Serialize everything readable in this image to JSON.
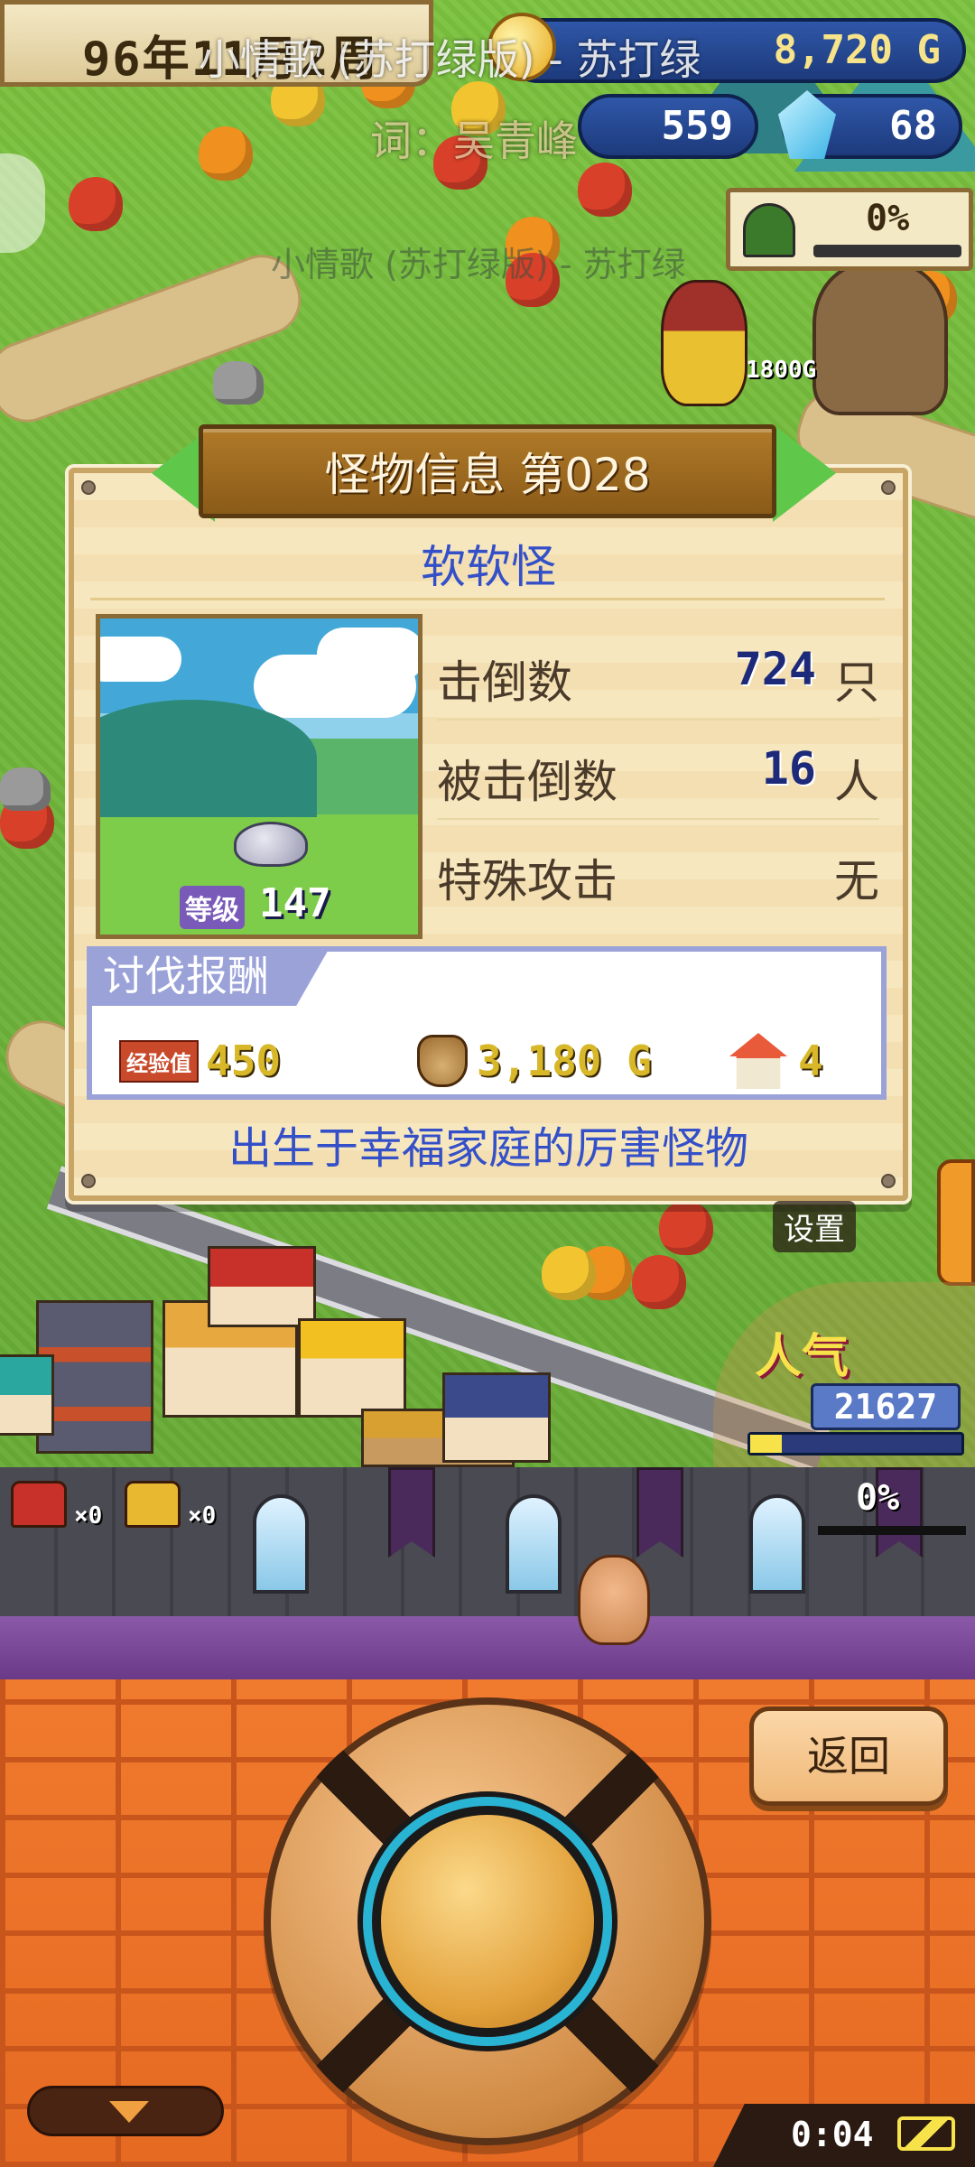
{
  "hud": {
    "date": "96年11月2周",
    "money": "8,720 G",
    "stat_value": "559",
    "gems": "68",
    "quest_progress": "0%"
  },
  "overlay_lyrics": {
    "line1": "小情歌 (苏打绿版) - 苏打绿",
    "line2": "词：吴青峰",
    "line3": "小情歌 (苏打绿版) - 苏打绿"
  },
  "map": {
    "price_tag": "1800G"
  },
  "dialog": {
    "title": "怪物信息 第028",
    "monster_name": "软软怪",
    "level_label": "等级",
    "level_value": "147",
    "stats": [
      {
        "label": "击倒数",
        "value": "724",
        "unit": "只"
      },
      {
        "label": "被击倒数",
        "value": "16",
        "unit": "人"
      },
      {
        "label": "特殊攻击",
        "value": "无"
      }
    ],
    "reward": {
      "title": "讨伐报酬",
      "exp_label": "经验值",
      "exp_value": "450",
      "gold_value": "3,180 G",
      "house_value": "4"
    },
    "flavor_text": "出生于幸福家庭的厉害怪物"
  },
  "side": {
    "settings_label": "设置",
    "popularity_label": "人气",
    "popularity_value": "21627",
    "popularity_fill": 0.15
  },
  "castle": {
    "chest_red_count": "×0",
    "chest_gold_count": "×0",
    "progress": "0%"
  },
  "controls": {
    "back_label": "返回"
  },
  "status": {
    "clock": "0:04"
  },
  "colors": {
    "accent_blue": "#3450c8",
    "stat_blue": "#1d2a7a",
    "panel_orange": "#e66a22",
    "popularity_yellow": "#f8e24a"
  }
}
